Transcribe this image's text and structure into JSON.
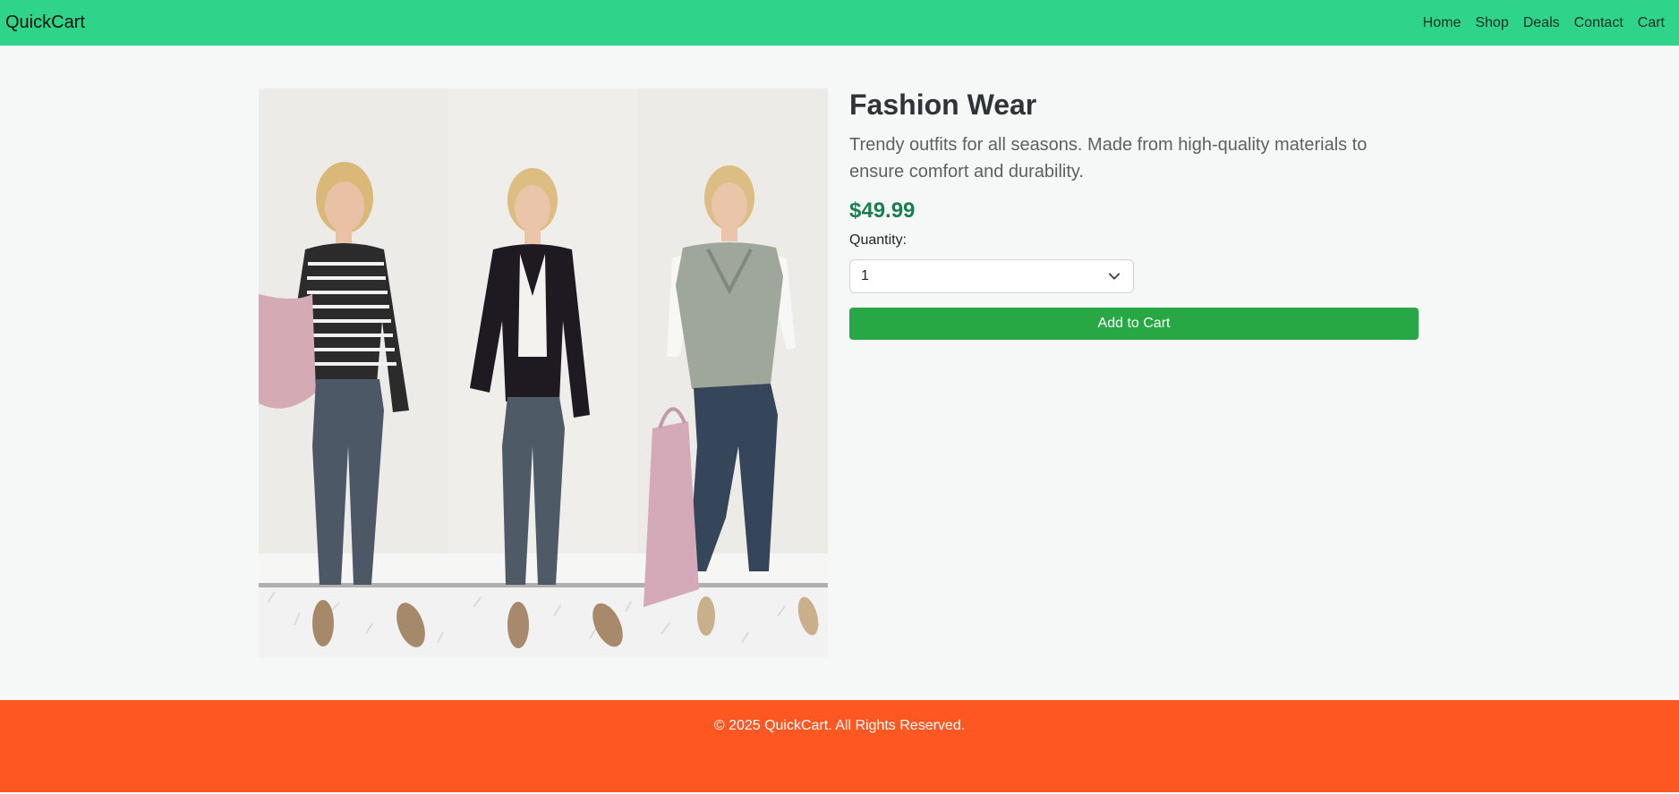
{
  "navbar": {
    "brand": "QuickCart",
    "links": [
      "Home",
      "Shop",
      "Deals",
      "Contact",
      "Cart"
    ],
    "background": "#2dd489"
  },
  "product": {
    "image_description_icon": "product-photo",
    "title": "Fashion Wear",
    "description": "Trendy outfits for all seasons. Made from high-quality materials to ensure comfort and durability.",
    "price": "$49.99",
    "price_color": "#1a7f4e",
    "quantity_label": "Quantity:",
    "quantity_selected": "1",
    "add_to_cart_label": "Add to Cart",
    "button_color": "#28a745"
  },
  "footer": {
    "text": "© 2025 QuickCart. All Rights Reserved.",
    "background": "#ff5722"
  }
}
